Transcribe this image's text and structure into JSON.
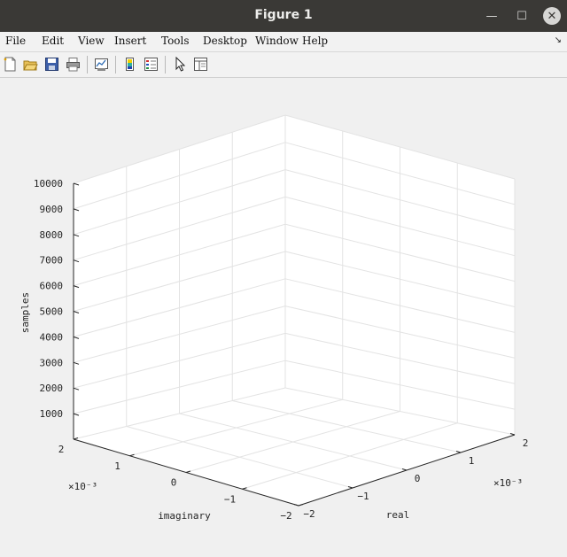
{
  "window": {
    "title": "Figure 1",
    "minimize_glyph": "—",
    "maximize_glyph": "☐",
    "close_glyph": "✕"
  },
  "menu": {
    "items": [
      "File",
      "Edit",
      "View",
      "Insert",
      "Tools",
      "Desktop",
      "Window",
      "Help"
    ],
    "overflow_glyph": "↘"
  },
  "toolbar": {
    "icons": [
      "new-figure-icon",
      "open-file-icon",
      "save-icon",
      "print-icon",
      "link-plot-icon",
      "insert-colorbar-icon",
      "insert-legend-icon",
      "pointer-icon",
      "property-inspector-icon"
    ]
  },
  "chart_data": {
    "type": "scatter",
    "title": "",
    "xlabel": "real",
    "ylabel": "imaginary",
    "zlabel": "samples",
    "x_exponent_label": "×10⁻³",
    "y_exponent_label": "×10⁻³",
    "xlim": [
      -0.002,
      0.002
    ],
    "ylim": [
      -0.002,
      0.002
    ],
    "zlim": [
      0,
      10000
    ],
    "x_ticks": [
      -2,
      -1,
      0,
      1,
      2
    ],
    "y_ticks": [
      2,
      1,
      0,
      -1,
      -2
    ],
    "z_ticks": [
      1000,
      2000,
      3000,
      4000,
      5000,
      6000,
      7000,
      8000,
      9000,
      10000
    ],
    "grid": true,
    "series": []
  }
}
